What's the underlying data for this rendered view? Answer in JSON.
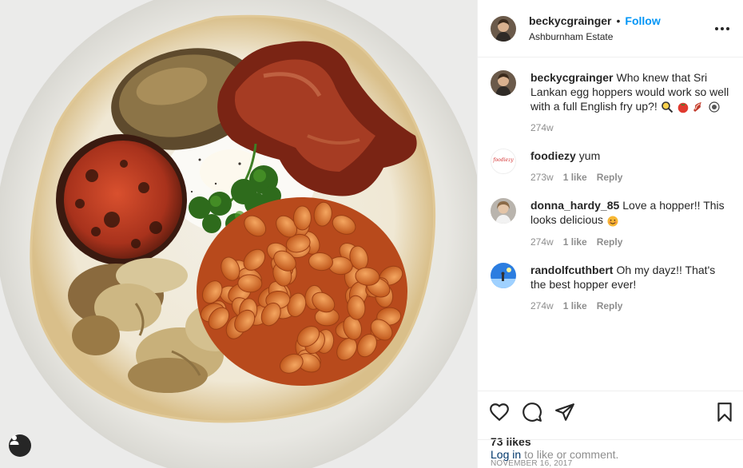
{
  "post": {
    "author": {
      "username": "beckycgrainger",
      "follow_label": "Follow",
      "separator": "•",
      "location": "Ashburnham Estate"
    },
    "more_icon": "more-horizontal-icon",
    "caption": {
      "username": "beckycgrainger",
      "text": "Who knew that Sri Lankan egg hoppers would work so well with a full English fry up?!",
      "emojis": [
        "magnifier-egg-icon",
        "tomato-icon",
        "bacon-icon",
        "plate-icon"
      ],
      "time": "274w"
    },
    "comments": [
      {
        "username": "foodiezy",
        "avatar_text": "foodiezy",
        "text": "yum",
        "time": "273w",
        "likes": "1 like",
        "reply": "Reply"
      },
      {
        "username": "donna_hardy_85",
        "text": "Love a hopper!! This looks delicious",
        "emoji": "smiling-face-icon",
        "time": "274w",
        "likes": "1 like",
        "reply": "Reply"
      },
      {
        "username": "randolfcuthbert",
        "text": "Oh my dayz!! That's the best hopper ever!",
        "time": "274w",
        "likes": "1 like",
        "reply": "Reply"
      }
    ],
    "actions": [
      "heart-icon",
      "comment-icon",
      "share-icon",
      "save-icon"
    ],
    "likes": "73 likes",
    "date": "November 16, 2017",
    "login": {
      "link": "Log in",
      "text": "to like or comment."
    }
  },
  "colors": {
    "follow": "#0095f6",
    "link": "#00376b",
    "muted": "#8e8e8e",
    "border": "#efefef"
  }
}
